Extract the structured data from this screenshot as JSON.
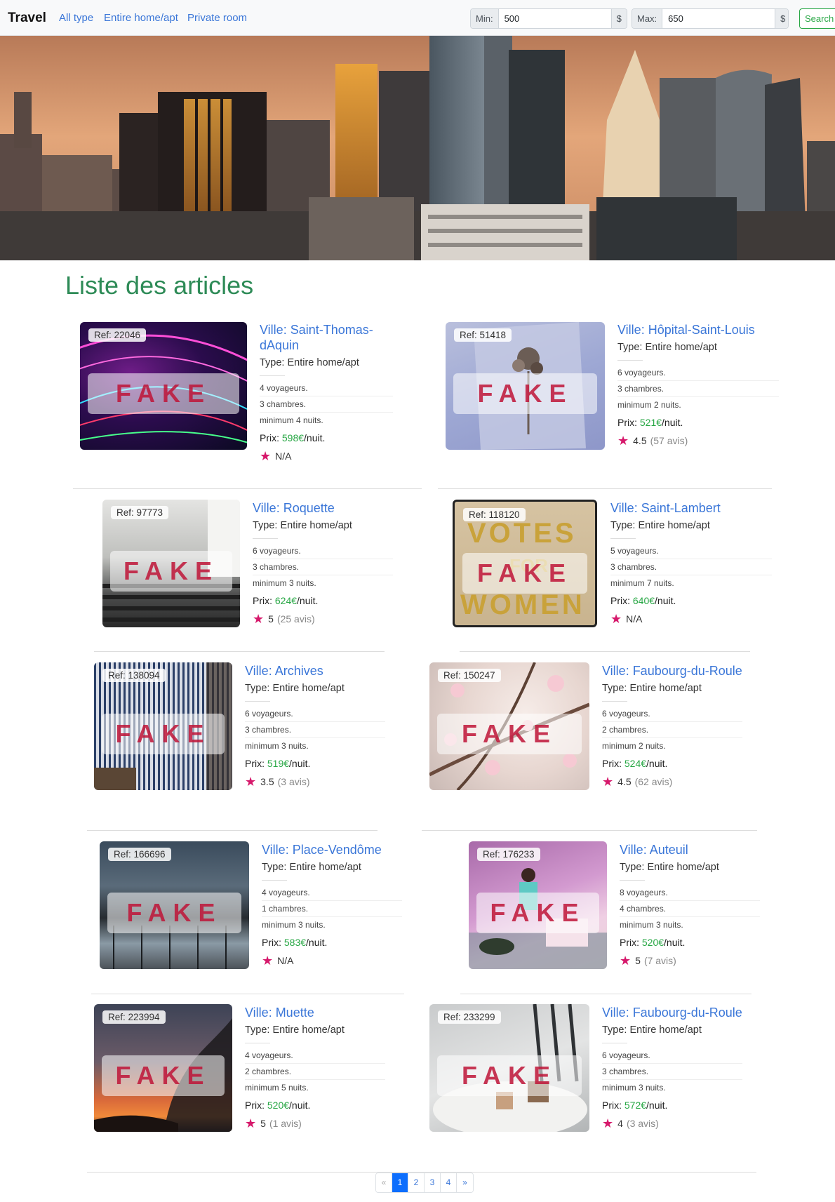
{
  "nav": {
    "brand": "Travel",
    "links": [
      "All type",
      "Entire home/apt",
      "Private room"
    ],
    "min_label": "Min:",
    "min_value": "500",
    "max_label": "Max:",
    "max_value": "650",
    "currency": "$",
    "search_label": "Search"
  },
  "page_title": "Liste des articles",
  "watermark": "FAKE",
  "listings": [
    {
      "ref": "Ref: 22046",
      "ville": "Ville: Saint-Thomas-dAquin",
      "type": "Type: Entire home/apt",
      "voyageurs": "4 voyageurs.",
      "chambres": "3 chambres.",
      "nuits": "minimum 4 nuits.",
      "prix_label": "Prix:",
      "prix": "598€",
      "prix_suffix": "/nuit.",
      "rating": "N/A",
      "reviews": "",
      "image": "neon-light-trails"
    },
    {
      "ref": "Ref: 51418",
      "ville": "Ville: Hôpital-Saint-Louis",
      "type": "Type: Entire home/apt",
      "voyageurs": "6 voyageurs.",
      "chambres": "3 chambres.",
      "nuits": "minimum 2 nuits.",
      "prix_label": "Prix:",
      "prix": "521€",
      "prix_suffix": "/nuit.",
      "rating": "4.5",
      "reviews": "(57 avis)",
      "image": "dried-flower-on-fabric"
    },
    {
      "ref": "Ref: 97773",
      "ville": "Ville: Roquette",
      "type": "Type: Entire home/apt",
      "voyageurs": "6 voyageurs.",
      "chambres": "3 chambres.",
      "nuits": "minimum 3 nuits.",
      "prix_label": "Prix:",
      "prix": "624€",
      "prix_suffix": "/nuit.",
      "rating": "5",
      "reviews": "(25 avis)",
      "image": "concrete-stairs"
    },
    {
      "ref": "Ref: 118120",
      "ville": "Ville: Saint-Lambert",
      "type": "Type: Entire home/apt",
      "voyageurs": "5 voyageurs.",
      "chambres": "3 chambres.",
      "nuits": "minimum 7 nuits.",
      "prix_label": "Prix:",
      "prix": "640€",
      "prix_suffix": "/nuit.",
      "rating": "N/A",
      "reviews": "",
      "image": "votes-for-women-banner"
    },
    {
      "ref": "Ref: 138094",
      "ville": "Ville: Archives",
      "type": "Type: Entire home/apt",
      "voyageurs": "6 voyageurs.",
      "chambres": "3 chambres.",
      "nuits": "minimum 3 nuits.",
      "prix_label": "Prix:",
      "prix": "519€",
      "prix_suffix": "/nuit.",
      "rating": "3.5",
      "reviews": "(3 avis)",
      "image": "striped-shirt"
    },
    {
      "ref": "Ref: 150247",
      "ville": "Ville: Faubourg-du-Roule",
      "type": "Type: Entire home/apt",
      "voyageurs": "6 voyageurs.",
      "chambres": "2 chambres.",
      "nuits": "minimum 2 nuits.",
      "prix_label": "Prix:",
      "prix": "524€",
      "prix_suffix": "/nuit.",
      "rating": "4.5",
      "reviews": "(62 avis)",
      "image": "cherry-blossoms"
    },
    {
      "ref": "Ref: 166696",
      "ville": "Ville: Place-Vendôme",
      "type": "Type: Entire home/apt",
      "voyageurs": "4 voyageurs.",
      "chambres": "1 chambres.",
      "nuits": "minimum 3 nuits.",
      "prix_label": "Prix:",
      "prix": "583€",
      "prix_suffix": "/nuit.",
      "rating": "N/A",
      "reviews": "",
      "image": "glass-building"
    },
    {
      "ref": "Ref: 176233",
      "ville": "Ville: Auteuil",
      "type": "Type: Entire home/apt",
      "voyageurs": "8 voyageurs.",
      "chambres": "4 chambres.",
      "nuits": "minimum 3 nuits.",
      "prix_label": "Prix:",
      "prix": "520€",
      "prix_suffix": "/nuit.",
      "rating": "5",
      "reviews": "(7 avis)",
      "image": "colorful-room"
    },
    {
      "ref": "Ref: 223994",
      "ville": "Ville: Muette",
      "type": "Type: Entire home/apt",
      "voyageurs": "4 voyageurs.",
      "chambres": "2 chambres.",
      "nuits": "minimum 5 nuits.",
      "prix_label": "Prix:",
      "prix": "520€",
      "prix_suffix": "/nuit.",
      "rating": "5",
      "reviews": "(1 avis)",
      "image": "sunset-smoke"
    },
    {
      "ref": "Ref: 233299",
      "ville": "Ville: Faubourg-du-Roule",
      "type": "Type: Entire home/apt",
      "voyageurs": "6 voyageurs.",
      "chambres": "3 chambres.",
      "nuits": "minimum 3 nuits.",
      "prix_label": "Prix:",
      "prix": "572€",
      "prix_suffix": "/nuit.",
      "rating": "4",
      "reviews": "(3 avis)",
      "image": "table-with-cups"
    }
  ],
  "pagination": {
    "prev": "«",
    "pages": [
      "1",
      "2",
      "3",
      "4"
    ],
    "next": "»",
    "active": "1"
  }
}
